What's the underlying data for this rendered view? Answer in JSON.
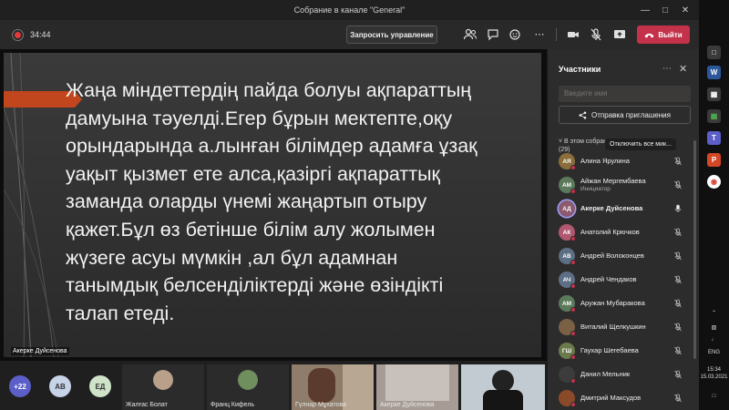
{
  "window": {
    "title": "Собрание в канале \"General\""
  },
  "toolbar": {
    "timer": "34:44",
    "take_control_label": "Запросить управление",
    "leave_label": "Выйти"
  },
  "slide": {
    "lines": [
      "Жаңа міндеттердің пайда болуы ақпараттың",
      "дамуына тәуелді.Егер бұрын мектепте,оқу",
      "орындарында а.лынған білімдер адамға ұзақ",
      "уақыт қызмет ете алса,қазіргі ақпараттық",
      "заманда оларды үнемі жаңартып отыру",
      "қажет.Бұл өз бетінше білім алу жолымен",
      "жүзеге асуы мүмкін ,ал бұл адамнан",
      "танымдық белсенділіктерді және өзіндікті",
      "талап етеді."
    ],
    "presenter": "Акерке Дуйсенова"
  },
  "strip": {
    "more_count": "+22",
    "bubbles": [
      "АВ",
      "ЕД"
    ],
    "tiles": [
      {
        "name": "Жалғас Болат"
      },
      {
        "name": "Франц Кифель"
      },
      {
        "name": "Гүлнар Мұхатова"
      },
      {
        "name": "Акерке Дуйсенова"
      },
      {
        "name": ""
      }
    ]
  },
  "panel": {
    "title": "Участники",
    "search_placeholder": "Введите имя",
    "invite_label": "Отправка приглашения",
    "section_label_1": "В этом собрании",
    "section_label_2": "(29)",
    "mute_all_tooltip": "Отключить все мик...",
    "participants": [
      {
        "initials": "АЯ",
        "name": "Алина Ярулина",
        "role": "",
        "color": "#8a6d3b",
        "speaking": false
      },
      {
        "initials": "АМ",
        "name": "Айжан Мергембаева",
        "role": "Инициатор",
        "color": "#5b7a5b",
        "speaking": false
      },
      {
        "initials": "АД",
        "name": "Акерке Дуйсенова",
        "role": "",
        "color": "#8b5a6e",
        "speaking": true
      },
      {
        "initials": "АК",
        "name": "Анатолий Крючков",
        "role": "",
        "color": "#b0586f",
        "speaking": false
      },
      {
        "initials": "АВ",
        "name": "Андрей Волоконцев",
        "role": "",
        "color": "#5c6f85",
        "speaking": false
      },
      {
        "initials": "АЧ",
        "name": "Андрей Чендаков",
        "role": "",
        "color": "#5c6f85",
        "speaking": false
      },
      {
        "initials": "АМ",
        "name": "Аружан Мубаракова",
        "role": "",
        "color": "#5b7a5b",
        "speaking": false
      },
      {
        "initials": "",
        "name": "Виталий Щелкушкин",
        "role": "",
        "color": "#7a6045",
        "speaking": false
      },
      {
        "initials": "ГШ",
        "name": "Гаухар Шегебаева",
        "role": "",
        "color": "#6b7a4a",
        "speaking": false
      },
      {
        "initials": "",
        "name": "Данил Мельник",
        "role": "",
        "color": "#3c3c3c",
        "speaking": false
      },
      {
        "initials": "",
        "name": "Дмитрий Максудов",
        "role": "",
        "color": "#8a4a2a",
        "speaking": false
      }
    ]
  },
  "taskbar": {
    "lang": "ENG",
    "time": "15:34",
    "date": "15.03.2021"
  }
}
